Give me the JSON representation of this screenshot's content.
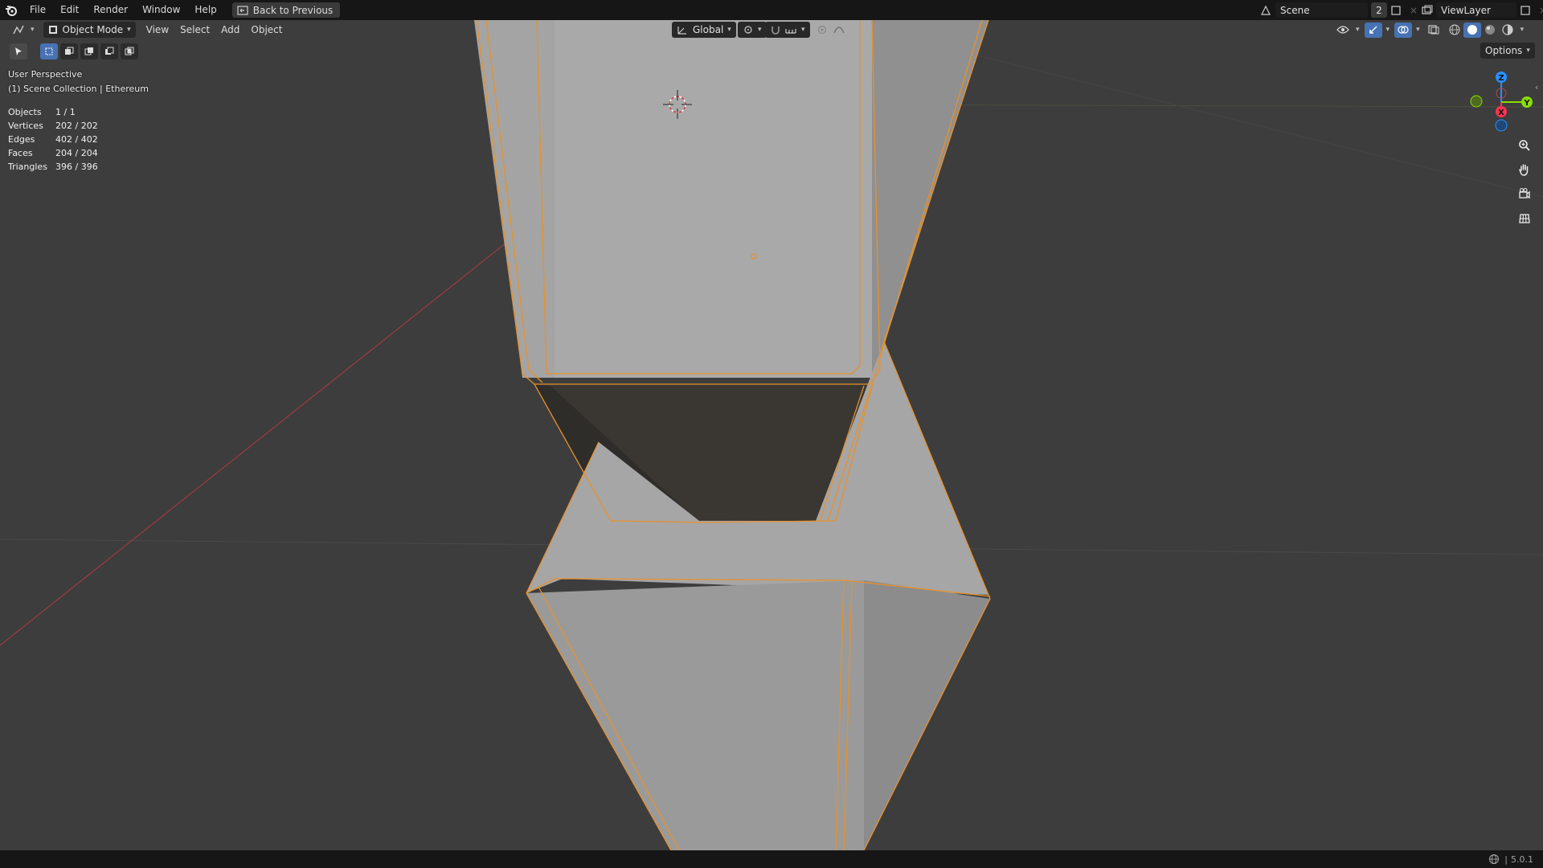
{
  "menu": {
    "items": [
      "File",
      "Edit",
      "Render",
      "Window",
      "Help"
    ],
    "back_button": "Back to Previous"
  },
  "scene": {
    "name": "Scene",
    "users": "2"
  },
  "viewlayer": {
    "name": "ViewLayer"
  },
  "viewport_header": {
    "mode": "Object Mode",
    "menus": [
      "View",
      "Select",
      "Add",
      "Object"
    ],
    "orientation": "Global",
    "options": "Options"
  },
  "overlay": {
    "perspective": "User Perspective",
    "collection": "(1) Scene Collection | Ethereum"
  },
  "stats": [
    {
      "label": "Objects",
      "value": "1 / 1"
    },
    {
      "label": "Vertices",
      "value": "202 / 202"
    },
    {
      "label": "Edges",
      "value": "402 / 402"
    },
    {
      "label": "Faces",
      "value": "204 / 204"
    },
    {
      "label": "Triangles",
      "value": "396 / 396"
    }
  ],
  "gizmo": {
    "x": "X",
    "y": "Y",
    "z": "Z"
  },
  "status": {
    "version": "5.0.1"
  },
  "colors": {
    "selection_outline": "#e8912a",
    "axis_x": "#ff3352",
    "axis_y": "#8bdc00",
    "axis_z": "#2890ff",
    "viewport_bg": "#3d3d3d"
  }
}
